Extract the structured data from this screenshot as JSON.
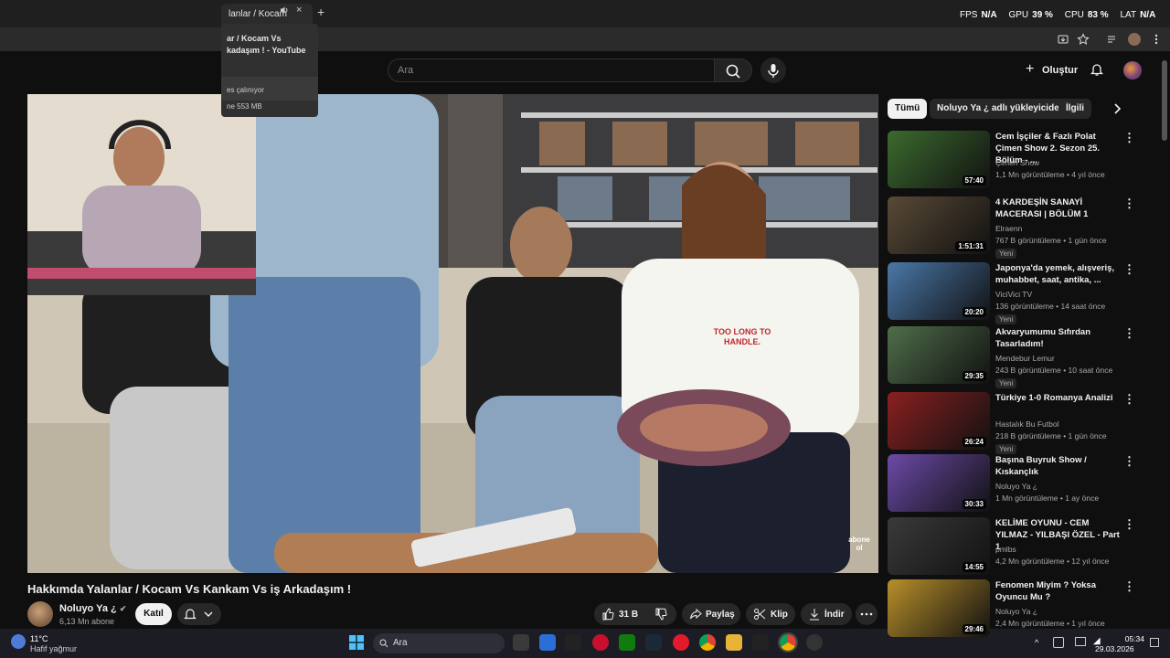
{
  "browser": {
    "tab_title": "lanlar / Kocam",
    "new_tab": "+",
    "tab_close": "×",
    "hovercard": {
      "title": "ar / Kocam Vs\nkadaşım ! - YouTube",
      "playing": "es çalınıyor",
      "memory": "ne 553 MB"
    }
  },
  "perf_overlay": {
    "fps_label": "FPS",
    "fps": "N/A",
    "gpu_label": "GPU",
    "gpu": "39",
    "cpu_label": "CPU",
    "cpu": "83",
    "lat_label": "LAT",
    "lat": "N/A",
    "unit": "%"
  },
  "youtube": {
    "search_placeholder": "Ara",
    "create_label": "Oluştur",
    "chips": [
      "Tümü",
      "Noluyo Ya ¿ adlı yükleyiciden",
      "İlgili"
    ],
    "video": {
      "title": "Hakkımda Yalanlar / Kocam Vs Kankam Vs iş Arkadaşım !",
      "shirt_text": "TOO LONG TO HANDLE.",
      "watermark": "abone ol"
    },
    "channel": {
      "name": "Noluyo Ya ¿",
      "subs": "6,13 Mn abone",
      "join_label": "Katıl"
    },
    "actions": {
      "likes": "31 B",
      "share": "Paylaş",
      "clip": "Klip",
      "download": "İndir"
    },
    "recommendations": [
      {
        "title": "Cem İşçiler & Fazlı Polat Çimen Show 2. Sezon 25. Bölüm - ...",
        "channel": "Çimen Show",
        "meta": "1,1 Mn görüntüleme • 4 yıl önce",
        "duration": "57:40",
        "new": "",
        "thumb_color": "#3b6b2e"
      },
      {
        "title": "4 KARDEŞİN SANAYİ MACERASI | BÖLÜM 1",
        "channel": "Elraenn",
        "meta": "767 B görüntüleme • 1 gün önce",
        "duration": "1:51:31",
        "new": "Yeni",
        "thumb_color": "#5a4a36"
      },
      {
        "title": "Japonya'da yemek, alışveriş, muhabbet, saat, antika, ...",
        "channel": "ViciVici TV",
        "meta": "136 görüntüleme • 14 saat önce",
        "duration": "20:20",
        "new": "Yeni",
        "thumb_color": "#4a78a8"
      },
      {
        "title": "Akvaryumumu Sıfırdan Tasarladım!",
        "channel": "Mendebur Lemur",
        "meta": "243 B görüntüleme • 10 saat önce",
        "duration": "29:35",
        "new": "Yeni",
        "thumb_color": "#4f6e4a"
      },
      {
        "title": "Türkiye 1-0 Romanya Analizi",
        "channel": "Hastalık Bu Futbol",
        "meta": "218 B görüntüleme • 1 gün önce",
        "duration": "26:24",
        "new": "Yeni",
        "thumb_color": "#8a2020"
      },
      {
        "title": "Başına Buyruk Show / Kıskançlık",
        "channel": "Noluyo Ya ¿",
        "meta": "1 Mn görüntüleme • 1 ay önce",
        "duration": "30:33",
        "new": "",
        "thumb_color": "#6c4aa8"
      },
      {
        "title": "KELİME OYUNU - CEM YILMAZ - YILBAŞI ÖZEL - Part 1",
        "channel": "pmlbs",
        "meta": "4,2 Mn görüntüleme • 12 yıl önce",
        "duration": "14:55",
        "new": "",
        "thumb_color": "#3a3a3a"
      },
      {
        "title": "Fenomen Miyim ? Yoksa Oyuncu Mu ?",
        "channel": "Noluyo Ya ¿",
        "meta": "2,4 Mn görüntüleme • 1 yıl önce",
        "duration": "29:46",
        "new": "",
        "thumb_color": "#b8902a"
      }
    ]
  },
  "taskbar": {
    "temp": "11°C",
    "weather": "Hafif yağmur",
    "search": "Ara",
    "time": "05:34",
    "date": "29.03.2026"
  },
  "colors": {
    "background": "#0f0f0f",
    "surface": "#272727",
    "text": "#f1f1f1",
    "muted": "#aaaaaa",
    "taskbar": "#1c1c24"
  }
}
